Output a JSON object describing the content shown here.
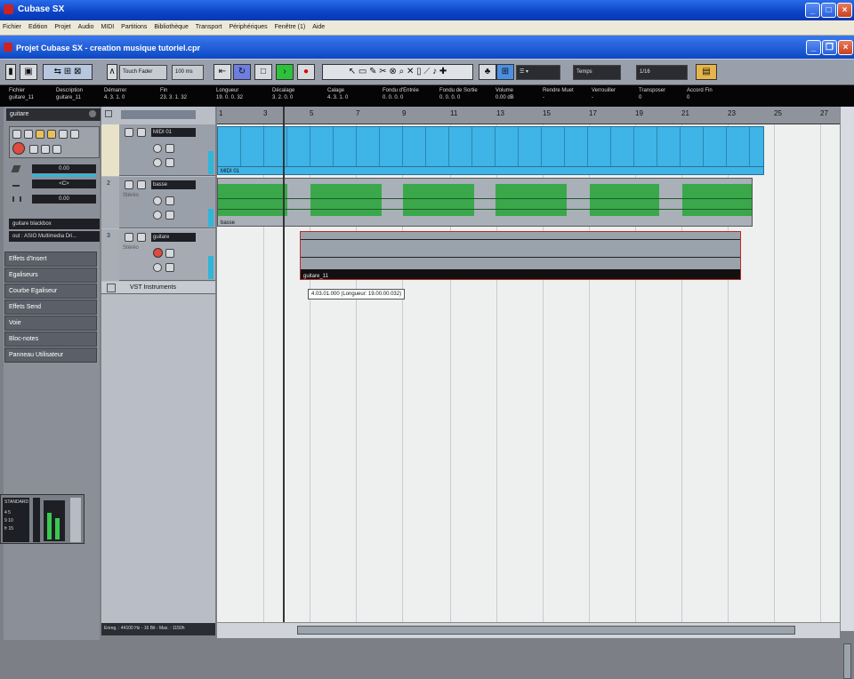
{
  "window": {
    "title": "Cubase SX"
  },
  "menu": [
    "Fichier",
    "Edition",
    "Projet",
    "Audio",
    "MIDI",
    "Partitions",
    "Bibliothèque",
    "Transport",
    "Périphériques",
    "Fenêtre (1)",
    "Aide"
  ],
  "project": {
    "title": "Projet Cubase SX - creation musique tutoriel.cpr"
  },
  "toolbar": {
    "automation_mode": "Touch Fader",
    "zoom_ms": "100 ms",
    "grid_type": "Temps",
    "quantize": "1/16"
  },
  "infoline": {
    "headers": [
      "Fichier",
      "Description",
      "Démarrer",
      "Fin",
      "Longueur",
      "Décalage",
      "Calage",
      "Fondu d'Entrée",
      "Fondu de Sortie",
      "Volume",
      "Rendre Muet",
      "Verrouiller",
      "Transposer",
      "Accord Fin"
    ],
    "values": [
      "guitare_11",
      "guitare_11",
      "4. 3. 1. 0",
      "23. 3. 1. 32",
      "19. 0. 0. 32",
      "3. 2. 0. 0",
      "4. 3. 1. 0",
      "0. 0. 0. 0",
      "0. 0. 0. 0",
      "0.00 dB",
      "-",
      "-",
      "0",
      "0"
    ]
  },
  "inspector": {
    "track_name": "guitare",
    "volume": "0.00",
    "pan": "<C>",
    "delay": "0.00",
    "input": "guitare blackbox",
    "output": "out : ASIO Multimedia Dri...",
    "sections": [
      "Effets d'Insert",
      "Egaliseurs",
      "Courbe Egaliseur",
      "Effets Send",
      "Voie",
      "Bloc-notes",
      "Panneau Utilisateur"
    ]
  },
  "tracks": [
    {
      "num": "1",
      "name": "MIDI 01",
      "mode": ""
    },
    {
      "num": "2",
      "name": "basse",
      "mode": "Stéréo"
    },
    {
      "num": "3",
      "name": "guitare",
      "mode": "Stéréo"
    }
  ],
  "vst_instruments": "VST Instruments",
  "ruler": {
    "bars": [
      "1",
      "3",
      "5",
      "7",
      "9",
      "11",
      "13",
      "15",
      "17",
      "19",
      "21",
      "23",
      "25",
      "27"
    ]
  },
  "parts": {
    "midi_label": "MIDI 01",
    "bass_label": "basse",
    "guitar_label": "guitare_11"
  },
  "tooltip": "4.03.01.000 (Longueur: 19.00.00.032)",
  "status": "Enreg. : 44100 Hz - 16 Bit - Max. : 1150h",
  "transport": {
    "label": "STANDARD",
    "rows": [
      "4 5",
      "9 10",
      "fr 15"
    ]
  },
  "colors": {
    "midi": "#3fb4e6",
    "audio_green": "#3aa84a",
    "accent": "#2fb6d8"
  }
}
